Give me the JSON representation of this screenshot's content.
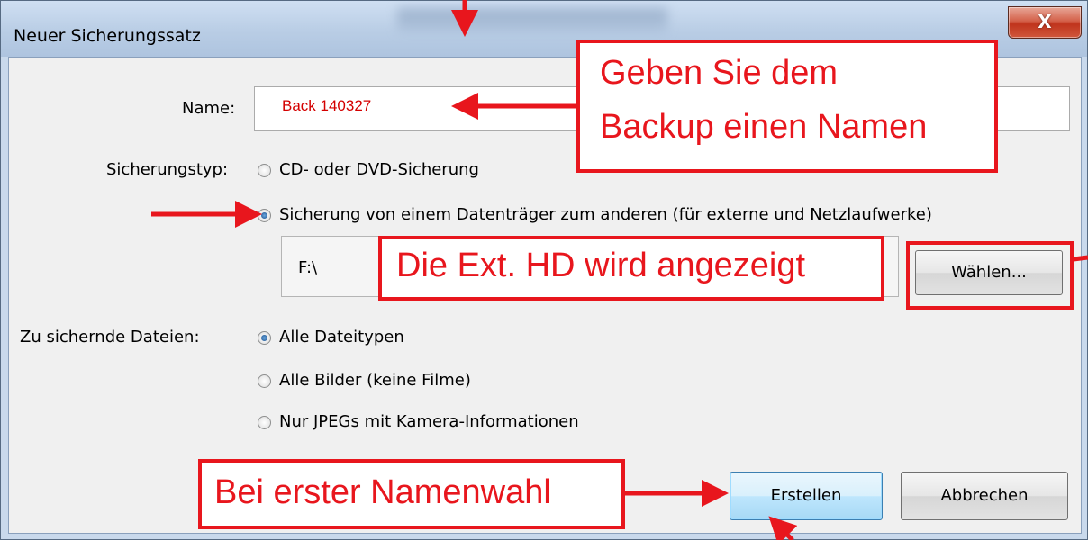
{
  "window": {
    "title": "Neuer Sicherungssatz",
    "close_glyph": "X"
  },
  "form": {
    "name_label": "Name:",
    "name_value": "Back 140327",
    "type_label": "Sicherungstyp:",
    "type_options": [
      {
        "label": "CD- oder DVD-Sicherung",
        "checked": false
      },
      {
        "label": "Sicherung von einem Datenträger zum anderen (für externe und Netzlaufwerke)",
        "checked": true
      }
    ],
    "path_value": "F:\\",
    "choose_button": "Wählen...",
    "files_label": "Zu sichernde Dateien:",
    "file_options": [
      {
        "label": "Alle Dateitypen",
        "checked": true
      },
      {
        "label": "Alle Bilder (keine Filme)",
        "checked": false
      },
      {
        "label": "Nur JPEGs mit Kamera-Informationen",
        "checked": false
      }
    ],
    "create_button": "Erstellen",
    "cancel_button": "Abbrechen"
  },
  "annotations": {
    "name_hint_line1": "Geben Sie dem",
    "name_hint_line2": "Backup einen Namen",
    "drive_hint": "Die Ext. HD wird angezeigt",
    "create_hint": "Bei erster Namenwahl",
    "color": "#e8161d"
  }
}
